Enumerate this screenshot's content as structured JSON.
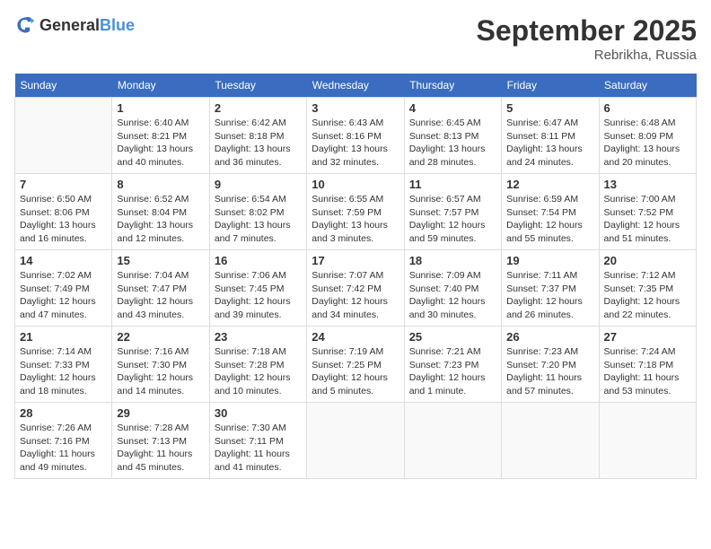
{
  "header": {
    "logo_general": "General",
    "logo_blue": "Blue",
    "month_title": "September 2025",
    "location": "Rebrikha, Russia"
  },
  "weekdays": [
    "Sunday",
    "Monday",
    "Tuesday",
    "Wednesday",
    "Thursday",
    "Friday",
    "Saturday"
  ],
  "weeks": [
    [
      {
        "day": "",
        "info": ""
      },
      {
        "day": "1",
        "info": "Sunrise: 6:40 AM\nSunset: 8:21 PM\nDaylight: 13 hours\nand 40 minutes."
      },
      {
        "day": "2",
        "info": "Sunrise: 6:42 AM\nSunset: 8:18 PM\nDaylight: 13 hours\nand 36 minutes."
      },
      {
        "day": "3",
        "info": "Sunrise: 6:43 AM\nSunset: 8:16 PM\nDaylight: 13 hours\nand 32 minutes."
      },
      {
        "day": "4",
        "info": "Sunrise: 6:45 AM\nSunset: 8:13 PM\nDaylight: 13 hours\nand 28 minutes."
      },
      {
        "day": "5",
        "info": "Sunrise: 6:47 AM\nSunset: 8:11 PM\nDaylight: 13 hours\nand 24 minutes."
      },
      {
        "day": "6",
        "info": "Sunrise: 6:48 AM\nSunset: 8:09 PM\nDaylight: 13 hours\nand 20 minutes."
      }
    ],
    [
      {
        "day": "7",
        "info": "Sunrise: 6:50 AM\nSunset: 8:06 PM\nDaylight: 13 hours\nand 16 minutes."
      },
      {
        "day": "8",
        "info": "Sunrise: 6:52 AM\nSunset: 8:04 PM\nDaylight: 13 hours\nand 12 minutes."
      },
      {
        "day": "9",
        "info": "Sunrise: 6:54 AM\nSunset: 8:02 PM\nDaylight: 13 hours\nand 7 minutes."
      },
      {
        "day": "10",
        "info": "Sunrise: 6:55 AM\nSunset: 7:59 PM\nDaylight: 13 hours\nand 3 minutes."
      },
      {
        "day": "11",
        "info": "Sunrise: 6:57 AM\nSunset: 7:57 PM\nDaylight: 12 hours\nand 59 minutes."
      },
      {
        "day": "12",
        "info": "Sunrise: 6:59 AM\nSunset: 7:54 PM\nDaylight: 12 hours\nand 55 minutes."
      },
      {
        "day": "13",
        "info": "Sunrise: 7:00 AM\nSunset: 7:52 PM\nDaylight: 12 hours\nand 51 minutes."
      }
    ],
    [
      {
        "day": "14",
        "info": "Sunrise: 7:02 AM\nSunset: 7:49 PM\nDaylight: 12 hours\nand 47 minutes."
      },
      {
        "day": "15",
        "info": "Sunrise: 7:04 AM\nSunset: 7:47 PM\nDaylight: 12 hours\nand 43 minutes."
      },
      {
        "day": "16",
        "info": "Sunrise: 7:06 AM\nSunset: 7:45 PM\nDaylight: 12 hours\nand 39 minutes."
      },
      {
        "day": "17",
        "info": "Sunrise: 7:07 AM\nSunset: 7:42 PM\nDaylight: 12 hours\nand 34 minutes."
      },
      {
        "day": "18",
        "info": "Sunrise: 7:09 AM\nSunset: 7:40 PM\nDaylight: 12 hours\nand 30 minutes."
      },
      {
        "day": "19",
        "info": "Sunrise: 7:11 AM\nSunset: 7:37 PM\nDaylight: 12 hours\nand 26 minutes."
      },
      {
        "day": "20",
        "info": "Sunrise: 7:12 AM\nSunset: 7:35 PM\nDaylight: 12 hours\nand 22 minutes."
      }
    ],
    [
      {
        "day": "21",
        "info": "Sunrise: 7:14 AM\nSunset: 7:33 PM\nDaylight: 12 hours\nand 18 minutes."
      },
      {
        "day": "22",
        "info": "Sunrise: 7:16 AM\nSunset: 7:30 PM\nDaylight: 12 hours\nand 14 minutes."
      },
      {
        "day": "23",
        "info": "Sunrise: 7:18 AM\nSunset: 7:28 PM\nDaylight: 12 hours\nand 10 minutes."
      },
      {
        "day": "24",
        "info": "Sunrise: 7:19 AM\nSunset: 7:25 PM\nDaylight: 12 hours\nand 5 minutes."
      },
      {
        "day": "25",
        "info": "Sunrise: 7:21 AM\nSunset: 7:23 PM\nDaylight: 12 hours\nand 1 minute."
      },
      {
        "day": "26",
        "info": "Sunrise: 7:23 AM\nSunset: 7:20 PM\nDaylight: 11 hours\nand 57 minutes."
      },
      {
        "day": "27",
        "info": "Sunrise: 7:24 AM\nSunset: 7:18 PM\nDaylight: 11 hours\nand 53 minutes."
      }
    ],
    [
      {
        "day": "28",
        "info": "Sunrise: 7:26 AM\nSunset: 7:16 PM\nDaylight: 11 hours\nand 49 minutes."
      },
      {
        "day": "29",
        "info": "Sunrise: 7:28 AM\nSunset: 7:13 PM\nDaylight: 11 hours\nand 45 minutes."
      },
      {
        "day": "30",
        "info": "Sunrise: 7:30 AM\nSunset: 7:11 PM\nDaylight: 11 hours\nand 41 minutes."
      },
      {
        "day": "",
        "info": ""
      },
      {
        "day": "",
        "info": ""
      },
      {
        "day": "",
        "info": ""
      },
      {
        "day": "",
        "info": ""
      }
    ]
  ]
}
